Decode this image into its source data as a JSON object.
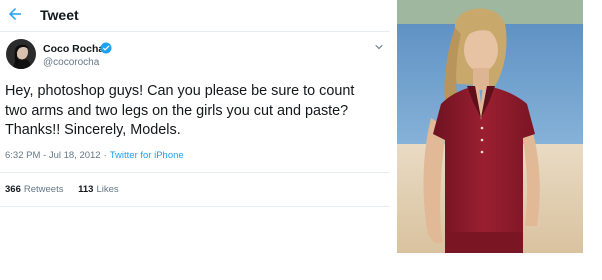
{
  "header": {
    "title": "Tweet",
    "back_icon": "back-arrow-icon"
  },
  "author": {
    "display_name": "Coco Rocha",
    "handle": "@cocorocha",
    "verified_icon": "verified-badge-icon",
    "avatar_icon": "avatar"
  },
  "tweet": {
    "text": "Hey, photoshop guys! Can you please be sure to count\ntwo arms and two legs on the girls you cut and paste?\nThanks!! Sincerely, Models.",
    "time": "6:32 PM - Jul 18, 2012",
    "separator": "·",
    "source": "Twitter for iPhone"
  },
  "stats": {
    "retweets_count": "366",
    "retweets_label": "Retweets",
    "likes_count": "113",
    "likes_label": "Likes"
  },
  "colors": {
    "accent": "#1da1f2",
    "text": "#14171a",
    "muted": "#657786",
    "border": "#e6ecf0",
    "shirt": "#8e1a2a"
  },
  "image": {
    "subject": "model in red polo shirt on beach"
  }
}
